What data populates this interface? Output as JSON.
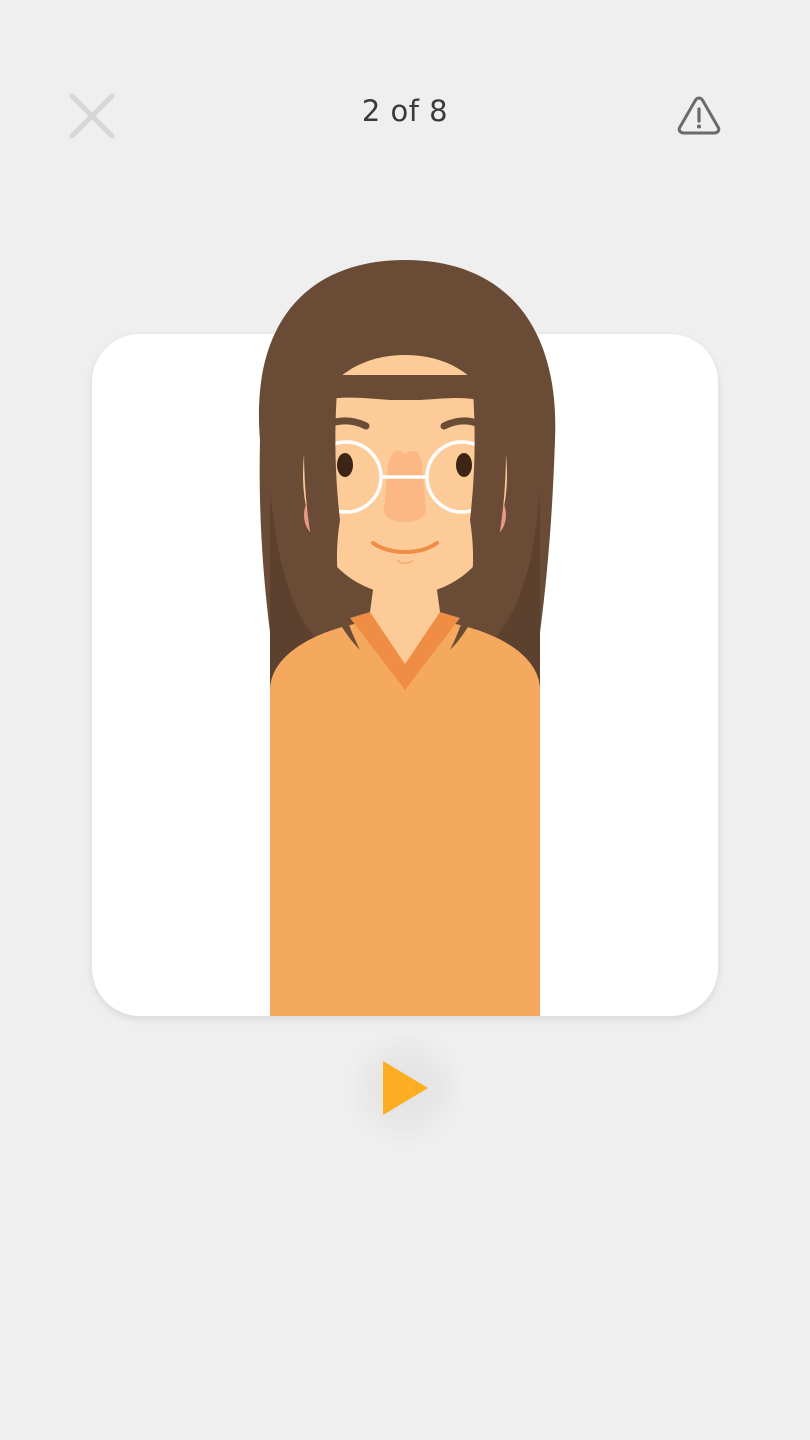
{
  "header": {
    "progress_text": "2 of 8",
    "close_icon": "close-icon",
    "report_icon": "warning-triangle-icon"
  },
  "card": {
    "illustration": "avatar-woman-with-glasses"
  },
  "controls": {
    "play_icon": "play-icon",
    "accent_color": "#fbae22"
  },
  "colors": {
    "background": "#efefef",
    "card": "#ffffff",
    "hair": "#6a4b36",
    "skin": "#fccb98",
    "shirt": "#f5a95f",
    "collar": "#f08d45"
  }
}
